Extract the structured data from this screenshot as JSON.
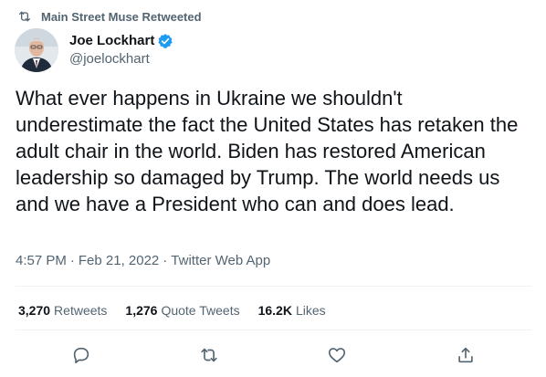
{
  "retweet_context": {
    "label": "Main Street Muse Retweeted",
    "icon": "retweet-icon"
  },
  "author": {
    "display_name": "Joe Lockhart",
    "handle": "@joelockhart",
    "verified": true,
    "verified_color": "#1d9bf0"
  },
  "tweet": {
    "text": "What ever happens in Ukraine we shouldn't underestimate the fact the United States has retaken the adult chair in the world. Biden has restored American leadership so damaged by Trump. The world needs us and we have a President who can and does lead."
  },
  "meta": {
    "time": "4:57 PM",
    "separator": "·",
    "date": "Feb 21, 2022",
    "source": "Twitter Web App"
  },
  "stats": {
    "retweets": {
      "count": "3,270",
      "label": "Retweets"
    },
    "quote_tweets": {
      "count": "1,276",
      "label": "Quote Tweets"
    },
    "likes": {
      "count": "16.2K",
      "label": "Likes"
    }
  },
  "actions": {
    "reply_icon": "reply-icon",
    "retweet_icon": "retweet-icon",
    "like_icon": "heart-icon",
    "share_icon": "share-icon"
  },
  "colors": {
    "text_primary": "#0f1419",
    "text_secondary": "#536471",
    "divider": "#eff3f4",
    "accent": "#1d9bf0"
  }
}
